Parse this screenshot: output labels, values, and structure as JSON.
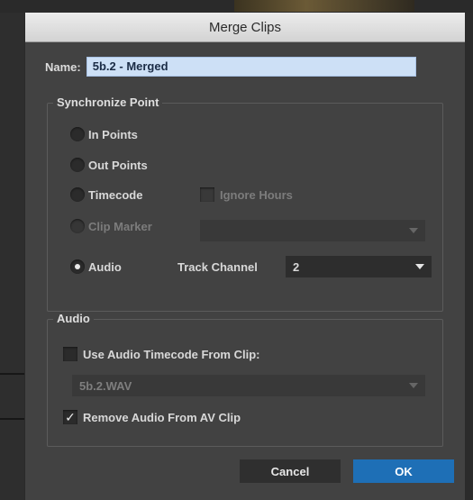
{
  "dialog": {
    "title": "Merge Clips",
    "name_label": "Name:",
    "name_value": "5b.2 - Merged",
    "sync_group": {
      "legend": "Synchronize Point",
      "in_points": "In Points",
      "out_points": "Out Points",
      "timecode": "Timecode",
      "ignore_hours": "Ignore Hours",
      "clip_marker": "Clip Marker",
      "clip_marker_value": "",
      "audio": "Audio",
      "track_channel_label": "Track Channel",
      "track_channel_value": "2"
    },
    "audio_group": {
      "legend": "Audio",
      "use_timecode_label": "Use Audio Timecode From Clip:",
      "clip_value": "5b.2.WAV",
      "remove_audio_label": "Remove Audio From AV Clip",
      "checkmark": "✓"
    },
    "buttons": {
      "cancel": "Cancel",
      "ok": "OK"
    }
  },
  "colors": {
    "accent": "#1e6fb6",
    "dialog_bg": "#424242",
    "name_field_bg": "#cde0f6"
  }
}
